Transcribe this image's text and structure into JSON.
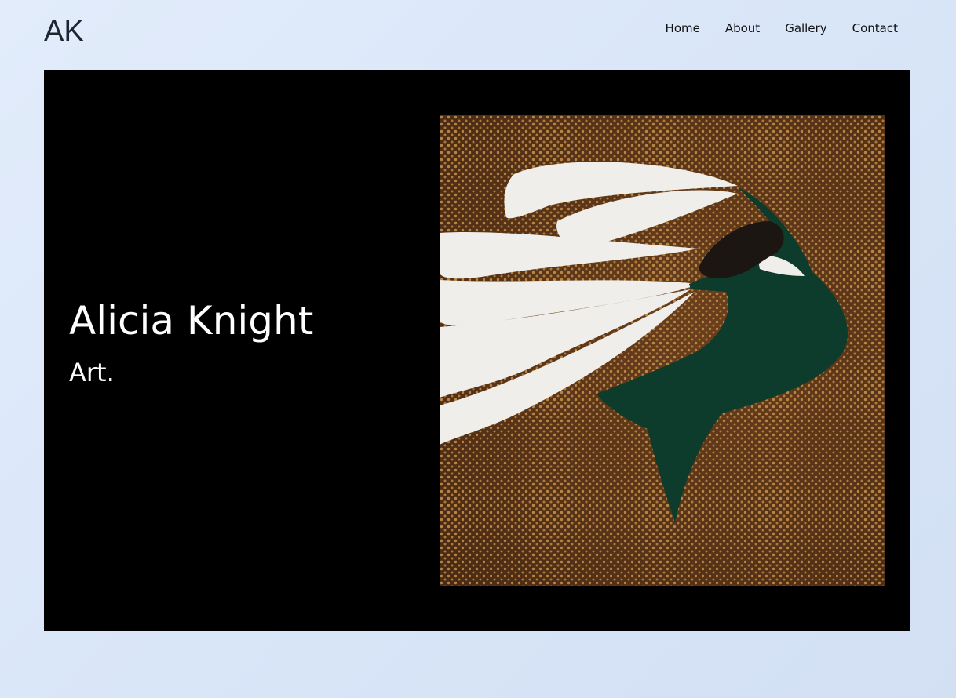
{
  "header": {
    "logo": "AK",
    "nav": [
      {
        "label": "Home"
      },
      {
        "label": "About"
      },
      {
        "label": "Gallery"
      },
      {
        "label": "Contact"
      }
    ]
  },
  "hero": {
    "title": "Alicia Knight",
    "subtitle": "Art."
  },
  "colors": {
    "page_background": "#dce7f8",
    "hero_background": "#000000",
    "artwork_background": "#5a3418",
    "artwork_dots": "#c9954a",
    "artwork_veil": "#efeeea",
    "artwork_figure": "#0d3b2c",
    "artwork_hair": "#1c1612"
  }
}
